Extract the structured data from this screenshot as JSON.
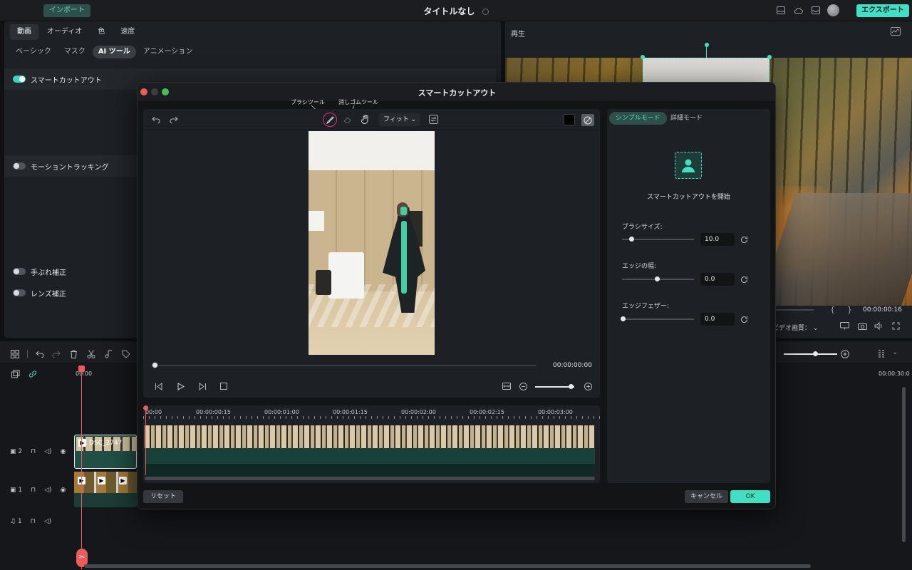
{
  "topbar": {
    "import_label": "インポート",
    "title": "タイトルなし",
    "export_label": "エクスポート"
  },
  "left_panel": {
    "tabs": [
      "動画",
      "オーディオ",
      "色",
      "速度"
    ],
    "subtabs": [
      "ベーシック",
      "マスク",
      "AI ツール",
      "アニメーション"
    ],
    "features": [
      {
        "label": "スマートカットアウト",
        "on": true
      },
      {
        "label": "モーショントラッキング",
        "on": false
      },
      {
        "label": "手ぶれ補正",
        "on": false
      },
      {
        "label": "レンズ補正",
        "on": false
      }
    ]
  },
  "preview": {
    "title": "再生",
    "timecode": "00:00:00:16",
    "quality_label": "ビデオ画質："
  },
  "timeline": {
    "ruler_start": "00:00",
    "ruler_end": "00:00:30:0",
    "clip_label": "DSC_2747",
    "tracks": [
      {
        "num": "2",
        "type": "video"
      },
      {
        "num": "1",
        "type": "video"
      },
      {
        "num": "1",
        "type": "audio"
      }
    ]
  },
  "modal": {
    "title": "スマートカットアウト",
    "tooltips": {
      "brush": "ブラシツール",
      "eraser": "消しゴムツール"
    },
    "fit_label": "フィット",
    "editor_timecode": "00:00:00:00",
    "ruler_labels": [
      "00:00",
      "00:00:00:15",
      "00:00:01:00",
      "00:00:01:15",
      "00:00:02:00",
      "00:00:02:15",
      "00:00:03:00"
    ],
    "mode_tabs": [
      "シンプルモード",
      "詳細モード"
    ],
    "start_label": "スマートカットアウトを開始",
    "params": [
      {
        "label": "ブラシサイズ:",
        "value": "10.0",
        "fraction": 0.1
      },
      {
        "label": "エッジの幅:",
        "value": "0.0",
        "fraction": 0.5
      },
      {
        "label": "エッジフェザー:",
        "value": "0.0",
        "fraction": 0.0
      }
    ],
    "reset_label": "リセット",
    "cancel_label": "キャンセル",
    "ok_label": "OK"
  },
  "colors": {
    "accent": "#3fe0c4",
    "playhead": "#f05a5a"
  }
}
